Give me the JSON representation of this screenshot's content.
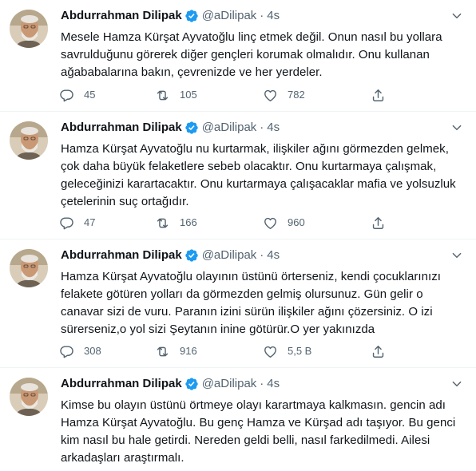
{
  "author": {
    "name": "Abdurrahman Dilipak",
    "handle": "@aDilipak",
    "separator": "·"
  },
  "colors": {
    "verified": "#1d9bf0",
    "text": "#0f1419",
    "secondary": "#536471",
    "divider": "#eff3f4"
  },
  "icons": {
    "reply": "reply-icon",
    "retweet": "retweet-icon",
    "like": "heart-icon",
    "share": "share-icon",
    "more": "chevron-down-icon",
    "verified": "verified-badge-icon"
  },
  "tweets": [
    {
      "time": "4s",
      "text": "Mesele Hamza Kürşat Ayvatoğlu linç etmek değil. Onun nasıl bu yollara\nsavrulduğunu görerek diğer gençleri korumak olmalıdır. Onu kullanan\nağababalarına bakın, çevrenizde ve her yerdeler.",
      "replies": "45",
      "retweets": "105",
      "likes": "782"
    },
    {
      "time": "4s",
      "text": "Hamza Kürşat Ayvatoğlu nu kurtarmak, ilişkiler ağını görmezden gelmek,\nçok daha büyük felaketlere sebeb olacaktır. Onu kurtarmaya çalışmak,\ngeleceğinizi karartacaktır. Onu kurtarmaya çalışacaklar mafia ve yolsuzluk\nçetelerinin suç ortağıdır.",
      "replies": "47",
      "retweets": "166",
      "likes": "960"
    },
    {
      "time": "4s",
      "text": "Hamza Kürşat Ayvatoğlu olayının üstünü örterseniz, kendi çocuklarınızı\nfelakete götüren yolları da görmezden gelmiş olursunuz. Gün gelir o\ncanavar sizi de vuru. Paranın izini sürün ilişkiler ağını çözersiniz. O izi\nsürerseniz,o yol sizi Şeytanın inine götürür.O yer yakınızda",
      "replies": "308",
      "retweets": "916",
      "likes": "5,5 B"
    },
    {
      "time": "4s",
      "text": "Kimse bu olayın üstünü örtmeye olayı karartmaya kalkmasın. gencin adı\nHamza Kürşat Ayvatoğlu. Bu genç Hamza ve Kürşad adı taşıyor. Bu genci\nkim nasıl bu hale getirdi. Nereden geldi belli, nasıl farkedilmedi. Ailesi\narkadaşları araştırmalı."
    }
  ]
}
